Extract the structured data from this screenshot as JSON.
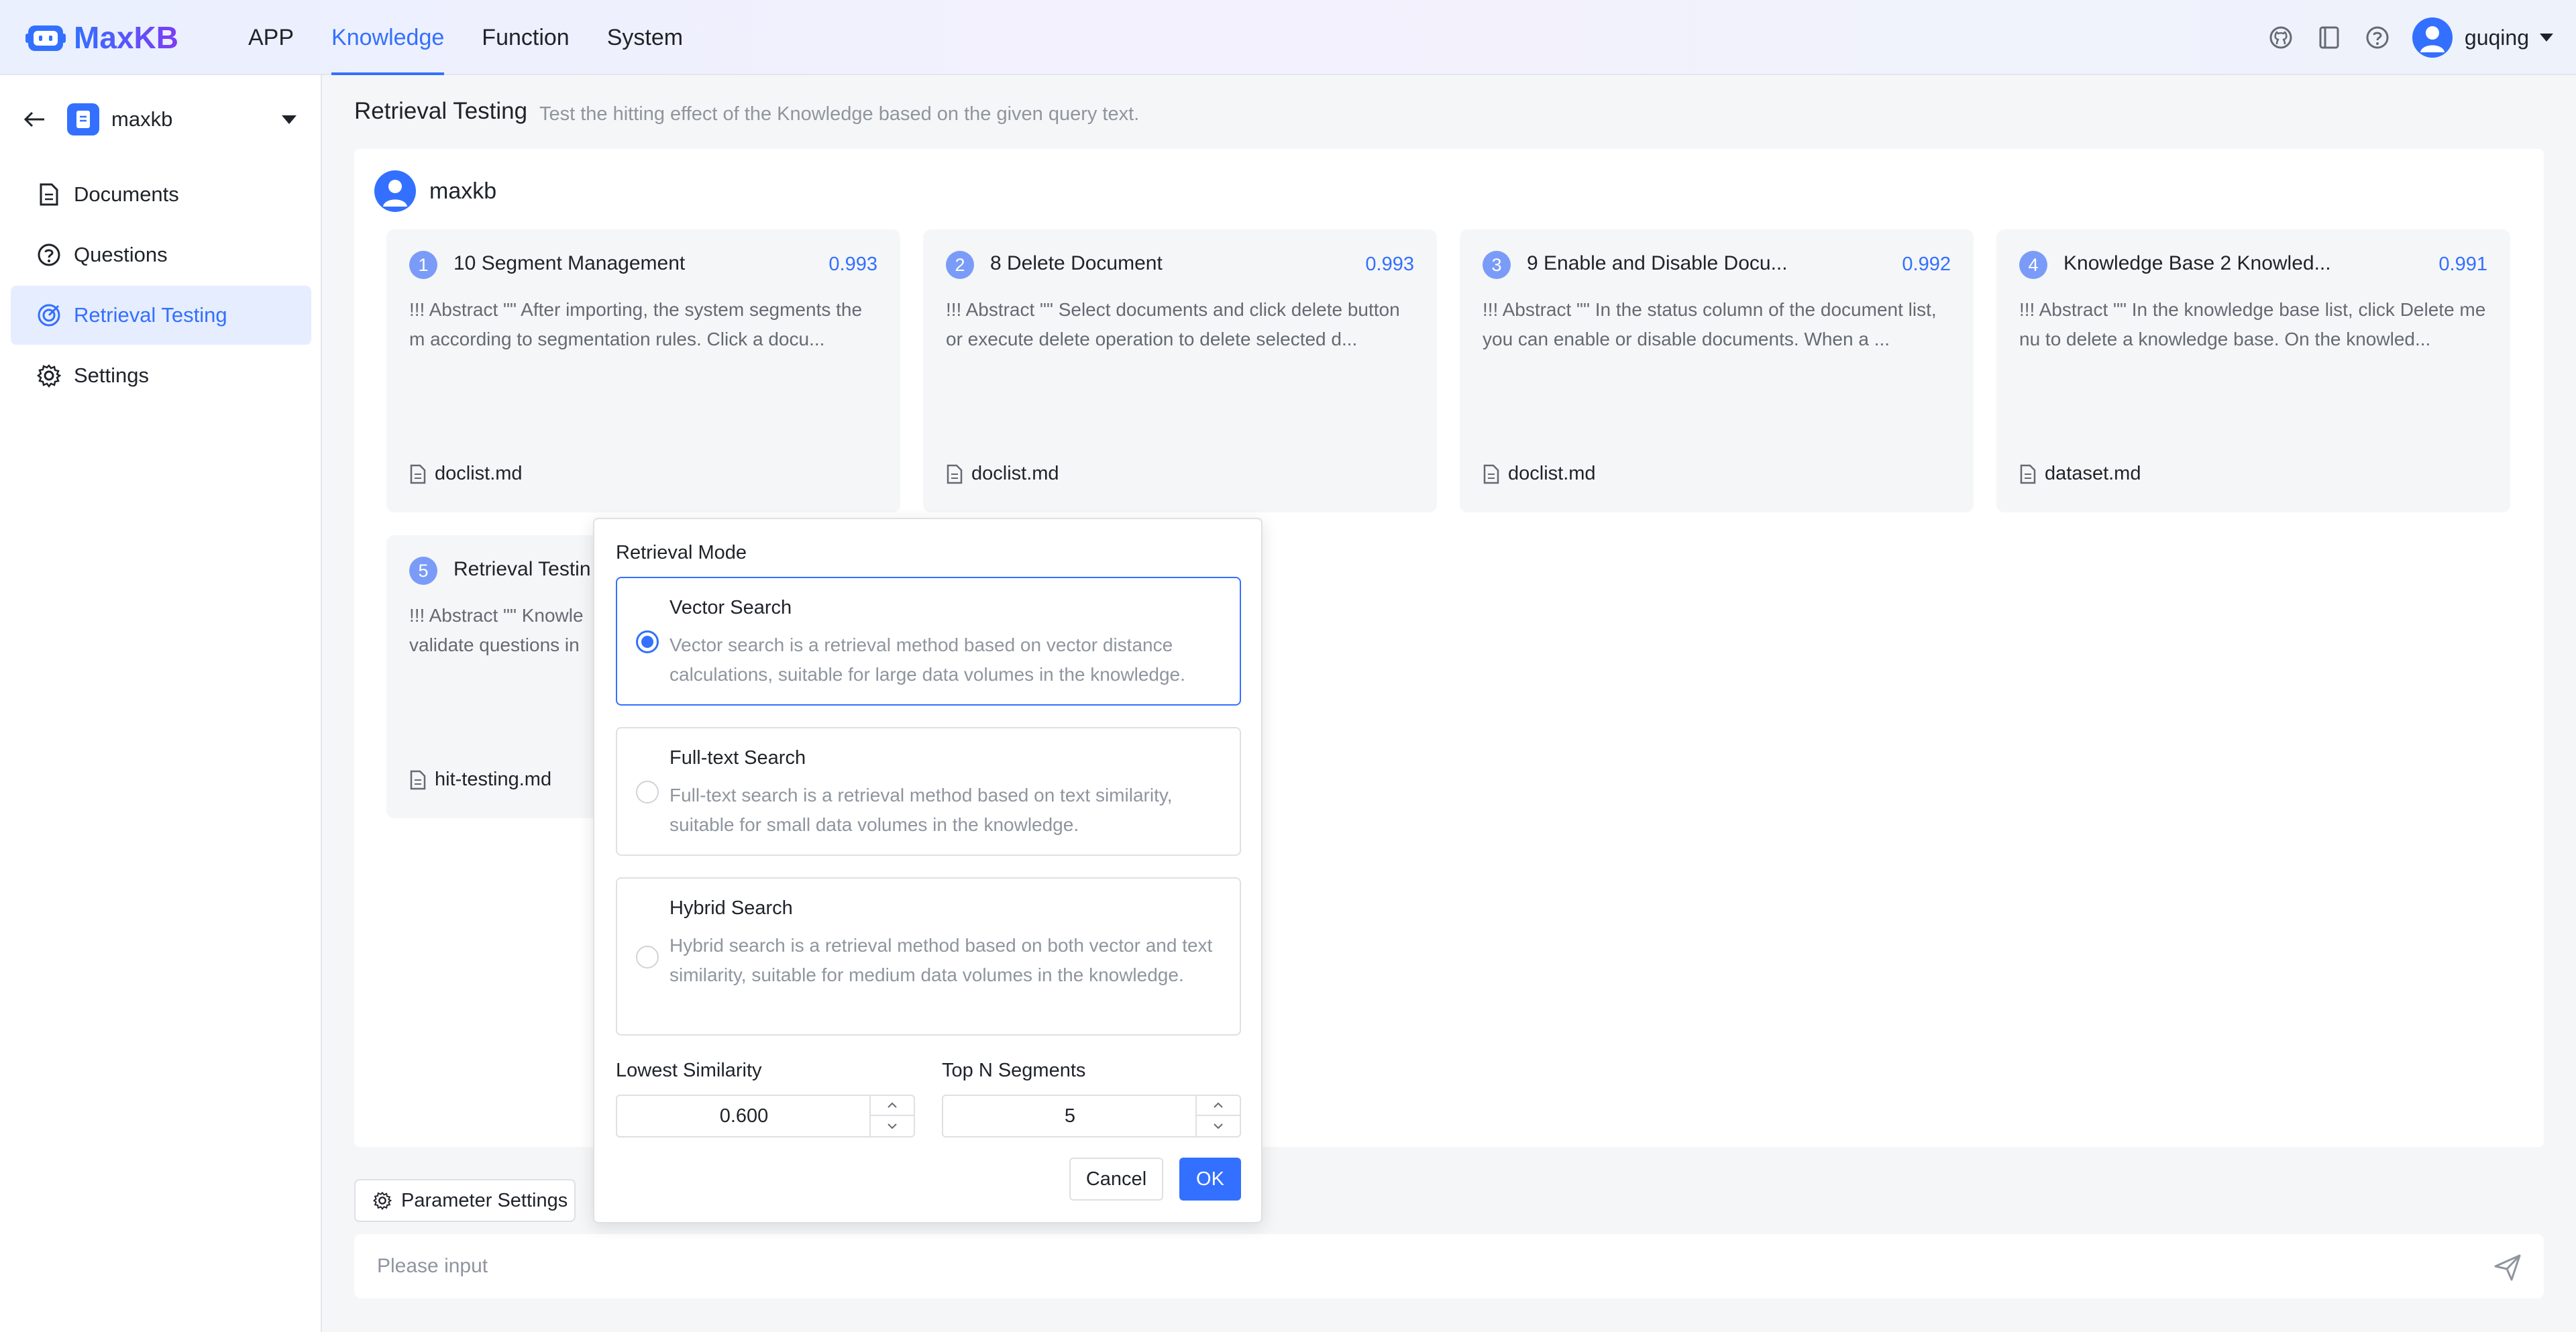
{
  "header": {
    "logo_text": "MaxKB",
    "nav": [
      {
        "label": "APP"
      },
      {
        "label": "Knowledge",
        "active": true
      },
      {
        "label": "Function"
      },
      {
        "label": "System"
      }
    ],
    "user_name": "guqing"
  },
  "sidebar": {
    "knowledge_name": "maxkb",
    "items": [
      {
        "label": "Documents",
        "icon": "document-icon"
      },
      {
        "label": "Questions",
        "icon": "question-circle-icon"
      },
      {
        "label": "Retrieval Testing",
        "icon": "target-icon",
        "active": true
      },
      {
        "label": "Settings",
        "icon": "gear-icon"
      }
    ]
  },
  "main": {
    "title": "Retrieval Testing",
    "subtitle": "Test the hitting effect of the Knowledge based on the given query text.",
    "query_user": "maxkb",
    "results": [
      {
        "index": "1",
        "title": "10 Segment Management",
        "score": "0.993",
        "abstract": "!!! Abstract \"\" After importing, the system segments them according to segmentation rules. Click a docu...",
        "file": "doclist.md"
      },
      {
        "index": "2",
        "title": "8 Delete Document",
        "score": "0.993",
        "abstract": "!!! Abstract \"\" Select documents and click delete button or execute delete operation to delete selected d...",
        "file": "doclist.md"
      },
      {
        "index": "3",
        "title": "9 Enable and Disable Docu...",
        "score": "0.992",
        "abstract": "!!! Abstract \"\" In the status column of the document list, you can enable or disable documents. When a ...",
        "file": "doclist.md"
      },
      {
        "index": "4",
        "title": "Knowledge Base 2 Knowled...",
        "score": "0.991",
        "abstract": "!!! Abstract \"\" In the knowledge base list, click Delete menu to delete a knowledge base. On the knowled...",
        "file": "dataset.md"
      },
      {
        "index": "5",
        "title": "Retrieval Testin",
        "abstract_line1": "!!! Abstract \"\" Knowle",
        "abstract_line2": "validate questions in",
        "file": "hit-testing.md"
      }
    ],
    "param_button": "Parameter Settings",
    "input_placeholder": "Please input"
  },
  "popover": {
    "label": "Retrieval Mode",
    "modes": [
      {
        "title": "Vector Search",
        "desc": "Vector search is a retrieval method based on vector distance calculations, suitable for large data volumes in the knowledge.",
        "selected": true
      },
      {
        "title": "Full-text Search",
        "desc": "Full-text search is a retrieval method based on text similarity, suitable for small data volumes in the knowledge.",
        "selected": false
      },
      {
        "title": "Hybrid Search",
        "desc": "Hybrid search is a retrieval method based on both vector and text similarity, suitable for medium data volumes in the knowledge.",
        "selected": false
      }
    ],
    "similarity_label": "Lowest Similarity",
    "similarity_value": "0.600",
    "topn_label": "Top N Segments",
    "topn_value": "5",
    "cancel_label": "Cancel",
    "ok_label": "OK"
  },
  "colors": {
    "accent": "#3370ff",
    "badge": "#7a9cf8",
    "active_bg": "#e6edfe"
  }
}
